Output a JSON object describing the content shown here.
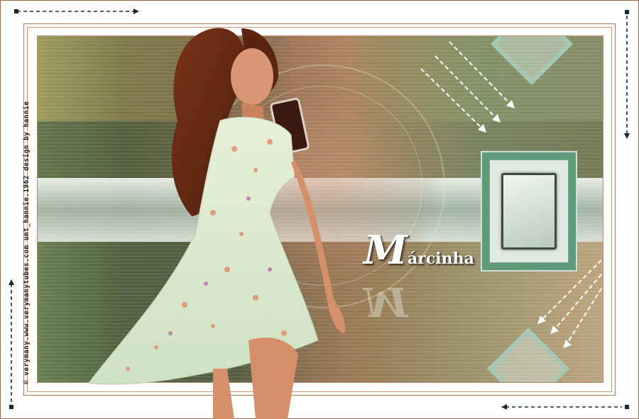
{
  "credit": "© verymany.www.verymanytubes.com umt_hannie.1962 design by hannie",
  "signature": {
    "initial": "M",
    "rest": "árcinha"
  },
  "icons": [
    "corner-arrow-icon",
    "dashed-arrow-icon"
  ],
  "colors": {
    "frame": "#a8643c",
    "accent": "#5f9a7a",
    "dark": "#1a2a2a"
  }
}
